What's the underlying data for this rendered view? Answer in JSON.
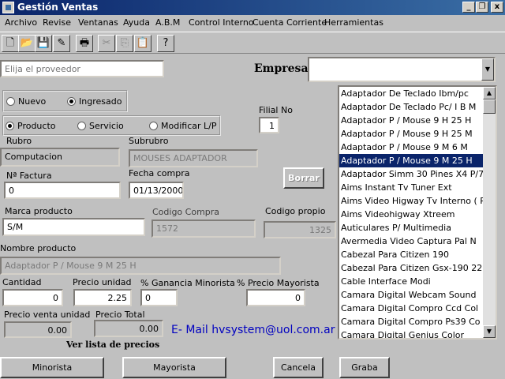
{
  "window": {
    "title": "Gestión Ventas",
    "min_label": "_",
    "max_label": "❐",
    "close_label": "x"
  },
  "menu": [
    "Archivo",
    "Revise",
    "Ventanas",
    "Ayuda",
    "A.B.M",
    "Control Interno",
    "Cuenta Corriente",
    "Herramientas"
  ],
  "toolbar": {
    "new_glyph": "🗋",
    "open_glyph": "📂",
    "save_glyph": "💾",
    "edit_glyph": "✎",
    "print_glyph": "🖶",
    "cut_glyph": "✂",
    "copy_glyph": "⎘",
    "paste_glyph": "📋",
    "help_glyph": "?"
  },
  "proveedor": {
    "placeholder": "Elija el proveedor"
  },
  "empresa": {
    "label": "Empresa",
    "value": ""
  },
  "modo": {
    "nuevo": "Nuevo",
    "ingresado": "Ingresado",
    "selected": "ingresado"
  },
  "tipo": {
    "producto": "Producto",
    "servicio": "Servicio",
    "modificar": "Modificar L/P",
    "selected": "producto"
  },
  "filial": {
    "label": "Filial No",
    "value": "1"
  },
  "rubro": {
    "label": "Rubro",
    "value": "Computacion"
  },
  "subrubro": {
    "label": "Subrubro",
    "value": "MOUSES ADAPTADOR"
  },
  "factura": {
    "label": "Nª  Factura",
    "value": "0"
  },
  "fecha": {
    "label": "Fecha compra",
    "value": "01/13/2000"
  },
  "borrar": {
    "label": "Borrar"
  },
  "marca": {
    "label": "Marca producto",
    "value": "S/M"
  },
  "codigo_compra": {
    "label": "Codigo Compra",
    "value": "1572"
  },
  "codigo_propio": {
    "label": "Codigo propio",
    "value": "1325"
  },
  "nombre": {
    "label": "Nombre producto",
    "value": "Adaptador P / Mouse 9 M 25 H"
  },
  "cantidad": {
    "label": "Cantidad",
    "value": "0"
  },
  "precio_unidad": {
    "label": "Precio unidad",
    "value": "2.25"
  },
  "ganancia": {
    "label": "% Ganancia Minorista",
    "value": "0"
  },
  "precio_mayorista": {
    "label": "% Precio Mayorista",
    "value": "0"
  },
  "precio_venta": {
    "label": "Precio venta unidad",
    "value": "0.00"
  },
  "precio_total": {
    "label": "Precio Total",
    "value": "0.00"
  },
  "email": {
    "label": "E- Mail  hvsystem@uol.com.ar"
  },
  "lista_precios": {
    "label": "Ver lista de precios"
  },
  "buttons": {
    "minorista": "Minorista",
    "mayorista": "Mayorista",
    "cancela": "Cancela",
    "graba": "Graba"
  },
  "colors": {
    "selection": "#0a246a",
    "email": "#0000c0",
    "titlebar": "#0a246a"
  },
  "products": [
    "Adaptador De Teclado Ibm/pc",
    "Adaptador De Teclado Pc/ I B M",
    "Adaptador P / Mouse 9 H 25 H",
    "Adaptador P / Mouse 9 H 25 M",
    "Adaptador P / Mouse 9 M  6 M",
    "Adaptador P / Mouse 9 M 25 H",
    "Adaptador Simm 30 Pines X4  P/7",
    "Aims Instant Tv Tuner Ext",
    "Aims Video Higway  Tv Interno ( P",
    "Aims Videohigway  Xtreem",
    "Auticulares P/ Multimedia",
    "Avermedia Video Captura Pal N",
    "Cabezal Para Citizen 190",
    "Cabezal Para Citizen Gsx-190 22",
    "Cable Interface Modi",
    "Camara Digital  Webcam Sound",
    "Camara Digital Compro  Ccd Col",
    "Camara Digital Compro  Ps39 Co",
    "Camara Digital Genius Color"
  ],
  "products_selected_index": 5
}
